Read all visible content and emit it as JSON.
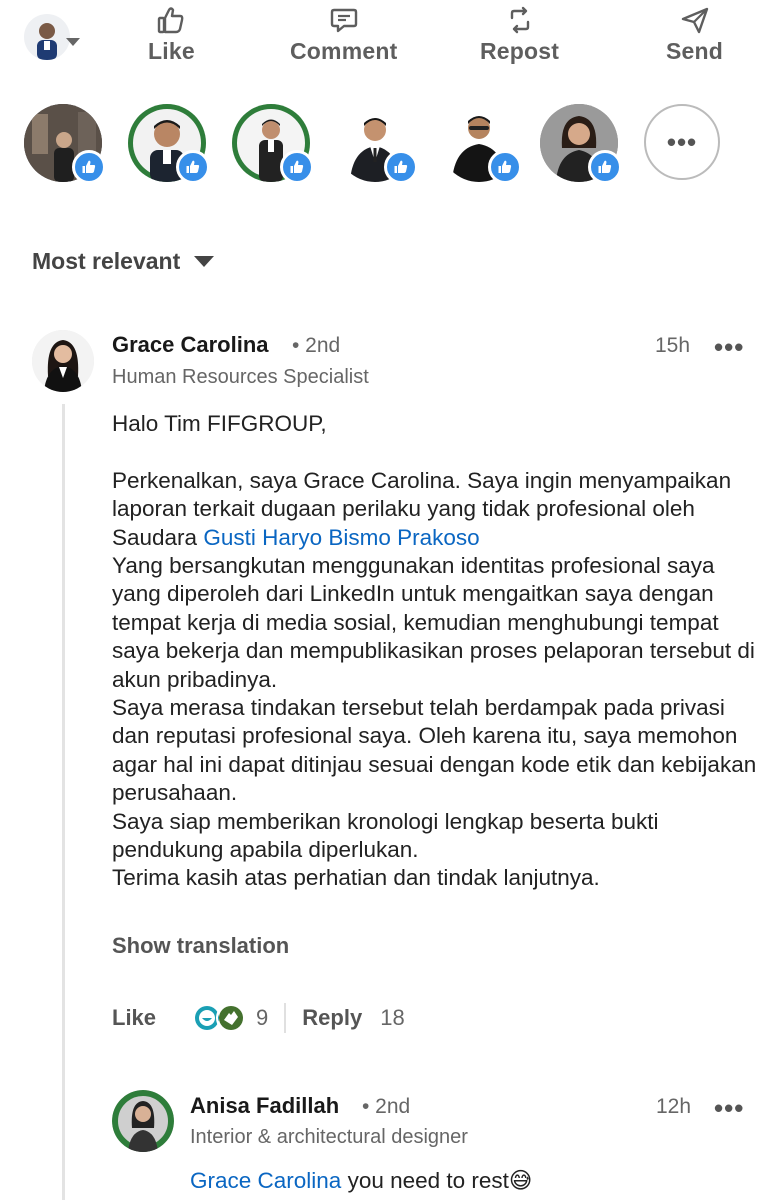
{
  "actions": {
    "like": "Like",
    "comment": "Comment",
    "repost": "Repost",
    "send": "Send"
  },
  "sort": {
    "label": "Most relevant"
  },
  "comment": {
    "name": "Grace Carolina",
    "degree": "• 2nd",
    "headline": "Human Resources Specialist",
    "time": "15h",
    "more": "•••",
    "greeting": "Halo Tim FIFGROUP,",
    "p1_start": "Perkenalkan, saya Grace Carolina. Saya ingin menyampaikan laporan terkait dugaan perilaku yang tidak profesional oleh Saudara ",
    "mention": "Gusti Haryo Bismo Prakoso",
    "p2": "Yang bersangkutan menggunakan identitas profesional saya yang diperoleh dari LinkedIn untuk mengaitkan saya dengan tempat kerja di media sosial, kemudian menghubungi tempat saya bekerja dan mempublikasikan proses pelaporan tersebut di akun pribadinya.",
    "p3": "Saya merasa tindakan tersebut telah berdampak pada privasi dan reputasi profesional saya. Oleh karena itu, saya memohon agar hal ini dapat ditinjau sesuai dengan kode etik dan kebijakan perusahaan.",
    "p4": "Saya siap memberikan kronologi lengkap beserta bukti pendukung apabila diperlukan.",
    "p5": "Terima kasih atas perhatian dan tindak lanjutnya.",
    "show_translation": "Show translation",
    "like_label": "Like",
    "reaction_count": "9",
    "reply_label": "Reply",
    "reply_count": "18"
  },
  "reply": {
    "name": "Anisa Fadillah",
    "degree": "• 2nd",
    "headline": "Interior & architectural designer",
    "time": "12h",
    "more": "•••",
    "mention": "Grace Carolina",
    "text": " you need to rest😅"
  },
  "colors": {
    "link": "#0a66c2",
    "like_badge": "#378fe9"
  },
  "icons": [
    "thumbs-up-icon",
    "comment-icon",
    "repost-icon",
    "send-icon",
    "caret-down-icon",
    "more-dots-icon"
  ]
}
